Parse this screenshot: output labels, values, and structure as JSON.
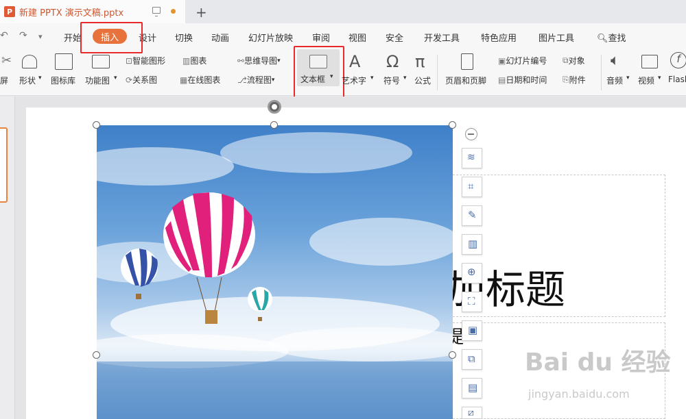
{
  "window": {
    "doc_title": "新建 PPTX 演示文稿.pptx",
    "logo": "P"
  },
  "menu": {
    "tabs": [
      "开始",
      "插入",
      "设计",
      "切换",
      "动画",
      "幻灯片放映",
      "审阅",
      "视图",
      "安全",
      "开发工具",
      "特色应用",
      "图片工具"
    ],
    "search": "查找"
  },
  "toolbar": {
    "screen_label": "屏",
    "shape_label": "形状",
    "icon_lib_label": "图标库",
    "func_chart_label": "功能图",
    "smart_graphic": "智能图形",
    "chart": "图表",
    "relation": "关系图",
    "online_chart": "在线图表",
    "mind_map": "思维导图",
    "flowchart": "流程图",
    "textbox": "文本框",
    "art_text": "艺术字",
    "symbol": "符号",
    "formula": "公式",
    "header_footer": "页眉和页脚",
    "slide_number": "幻灯片编号",
    "object": "对象",
    "datetime": "日期和时间",
    "attachment": "附件",
    "audio": "音频",
    "video": "视频",
    "flash": "Flash"
  },
  "slide": {
    "title_partial": "加标题",
    "subtitle_partial": "提"
  },
  "watermark": {
    "brand": "Bai du 经验",
    "url": "jingyan.baidu.com"
  },
  "colors": {
    "accent": "#e8723c",
    "highlight": "#e8282a"
  }
}
